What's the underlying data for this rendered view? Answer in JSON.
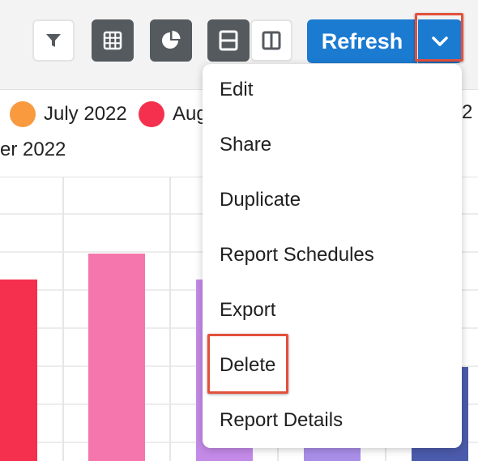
{
  "toolbar": {
    "refresh_label": "Refresh",
    "buttons": [
      {
        "name": "filter",
        "icon": "filter-icon"
      },
      {
        "name": "table-view",
        "icon": "grid-icon"
      },
      {
        "name": "chart-view",
        "icon": "pie-chart-icon"
      },
      {
        "name": "layout-horizontal",
        "icon": "split-horizontal-icon"
      },
      {
        "name": "layout-vertical",
        "icon": "split-vertical-icon"
      }
    ],
    "dropdown_icon": "chevron-down-icon"
  },
  "legend": {
    "items": [
      {
        "label": "July 2022",
        "color": "#f99a3e"
      },
      {
        "label": "Aug",
        "color": "#f5304e"
      },
      {
        "label": "2",
        "color": ""
      },
      {
        "label": "er 2022",
        "color": ""
      }
    ]
  },
  "chart_data": {
    "type": "bar",
    "note": "partially obscured by menu",
    "bar_colors": [
      "#f5304e",
      "#f576ad",
      "#c48ae8",
      "#a98ee8",
      "#4b5bab"
    ],
    "values_visible": false
  },
  "menu": {
    "items": [
      "Edit",
      "Share",
      "Duplicate",
      "Report Schedules",
      "Export",
      "Delete",
      "Report Details"
    ],
    "highlighted": "Delete"
  },
  "colors": {
    "primary": "#1b7bd1",
    "highlight": "#e3503c",
    "dark_button": "#555a5f"
  }
}
